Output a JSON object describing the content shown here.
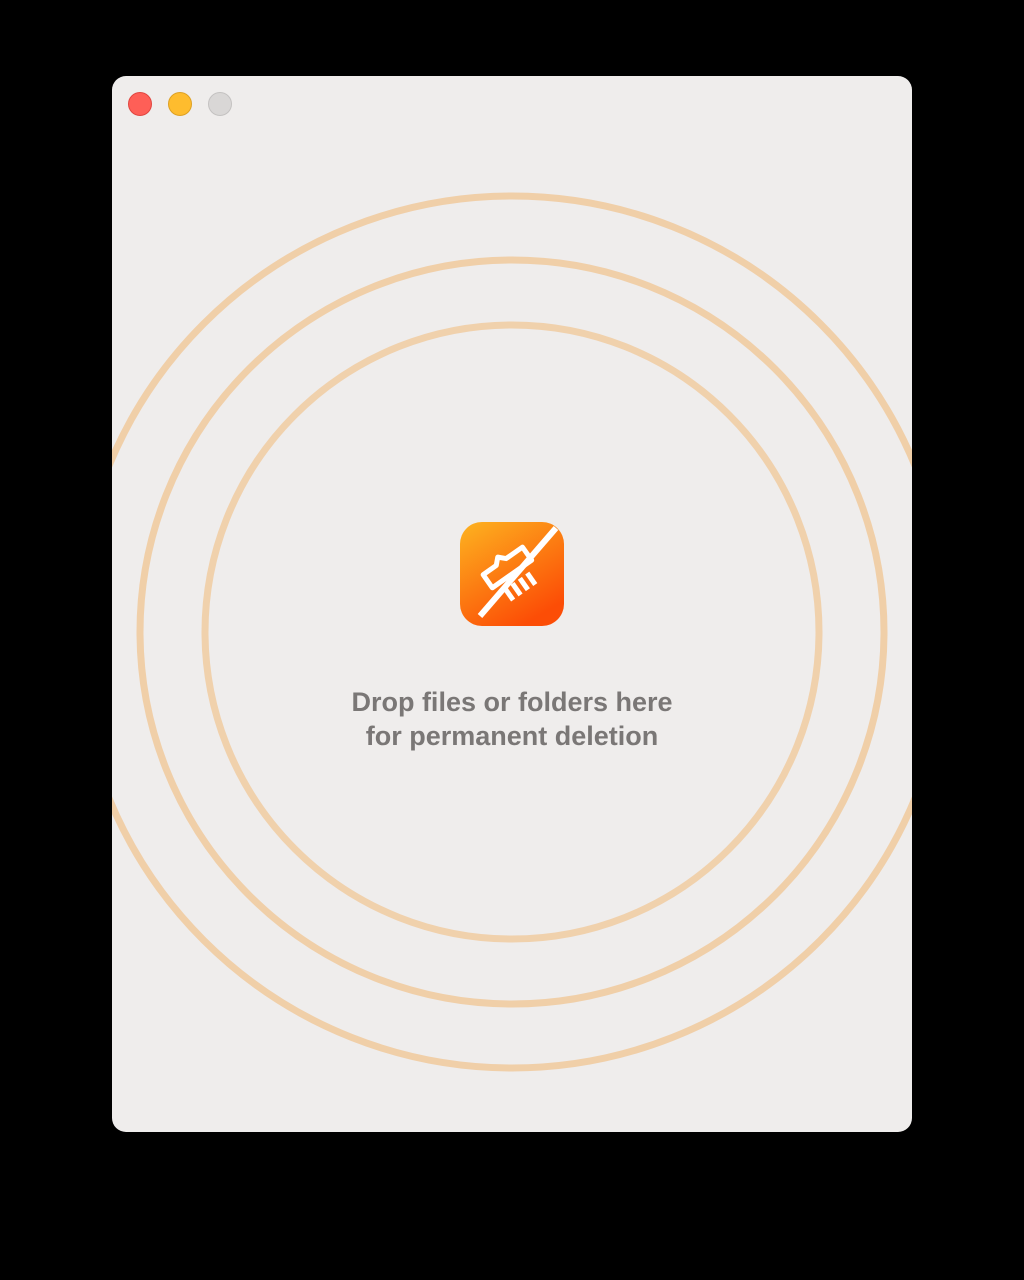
{
  "window": {
    "title": "",
    "controls": {
      "close": "close-button",
      "minimize": "minimize-button",
      "zoom": "zoom-button"
    }
  },
  "drop_zone": {
    "icon": "shredder-icon",
    "line1": "Drop files or folders here",
    "line2": "for permanent deletion"
  },
  "colors": {
    "window_bg": "#efedec",
    "ring": "#f0c99c",
    "text": "#7a7776",
    "icon_top": "#fdb320",
    "icon_bottom": "#fc4d06",
    "close": "#fe5f57",
    "minimize": "#febc2e",
    "zoom": "#d9d7d6"
  }
}
